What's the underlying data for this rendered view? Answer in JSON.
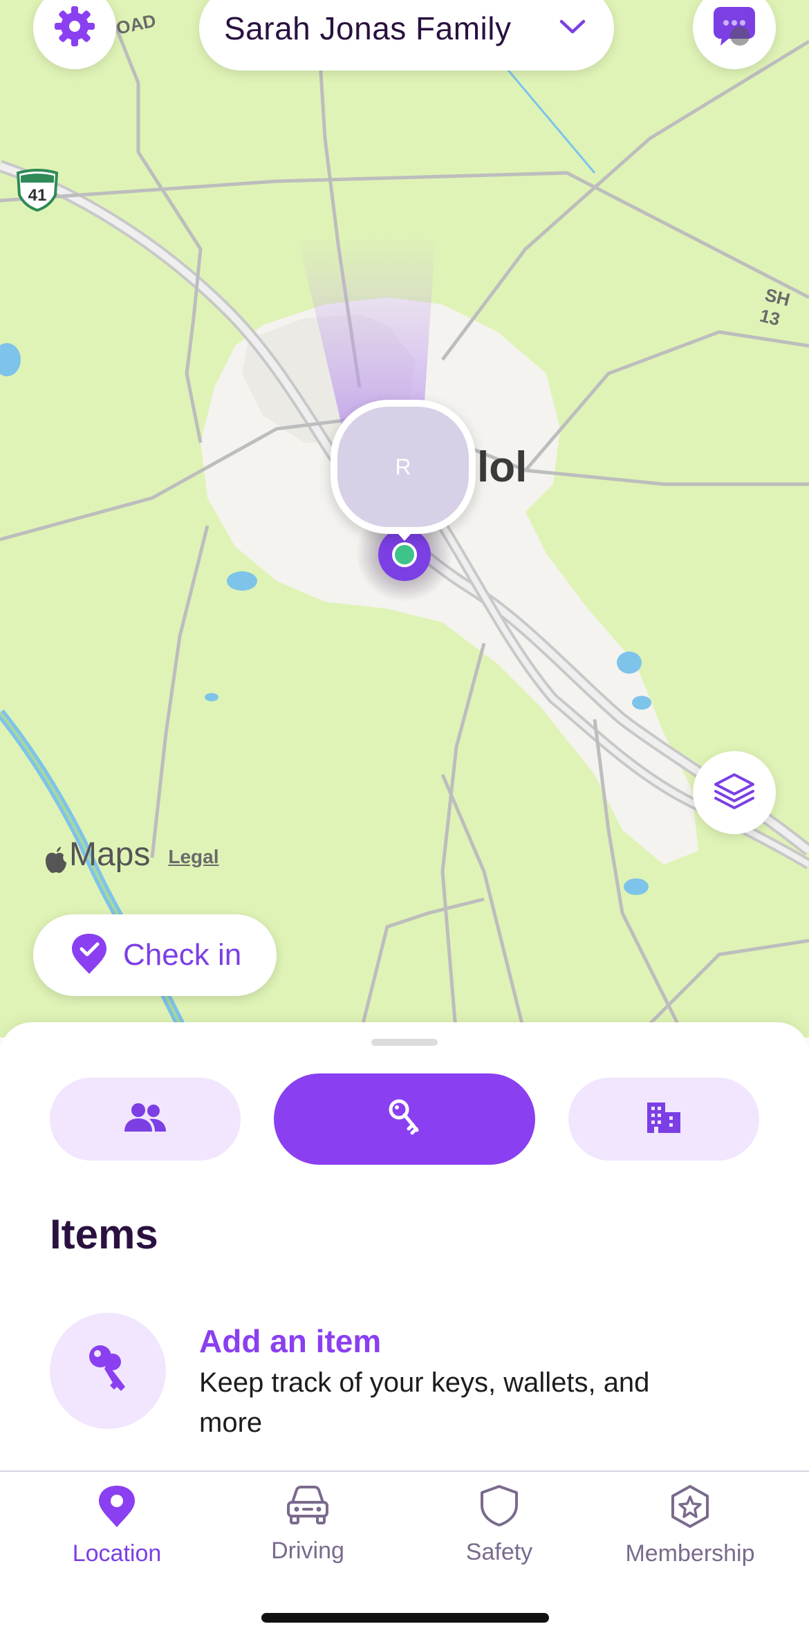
{
  "header": {
    "family_name": "Sarah Jonas Family"
  },
  "map": {
    "city_label": "lol",
    "road_shield": "41",
    "road_label_right": "SH 13",
    "road_label_top": "OAD",
    "avatar_initial": "R",
    "attribution": "Maps",
    "legal_label": "Legal",
    "checkin_label": "Check in"
  },
  "sheet": {
    "segments": [
      "people",
      "items",
      "places"
    ],
    "active_segment": "items",
    "title": "Items",
    "add_item": {
      "title": "Add an item",
      "description": "Keep track of your keys, wallets, and more"
    }
  },
  "tabs": [
    {
      "label": "Location",
      "icon": "location-pin-icon",
      "active": true
    },
    {
      "label": "Driving",
      "icon": "car-icon",
      "active": false
    },
    {
      "label": "Safety",
      "icon": "shield-icon",
      "active": false
    },
    {
      "label": "Membership",
      "icon": "star-badge-icon",
      "active": false
    }
  ],
  "colors": {
    "accent": "#8a3ff0",
    "accent_light": "#f1e6fd",
    "map_green": "#dff3b6",
    "text_dark": "#2a1140"
  }
}
